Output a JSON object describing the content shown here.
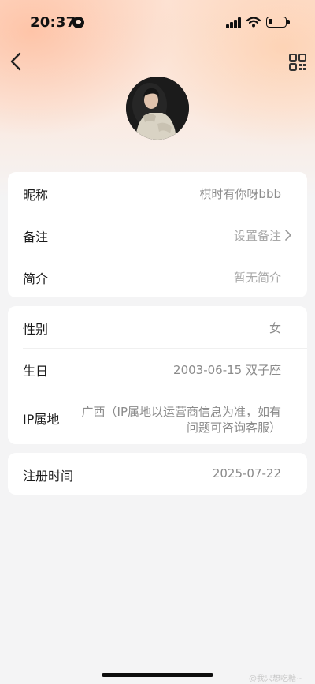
{
  "status_bar": {
    "time": "20:37",
    "battery_level": 0.25
  },
  "header": {
    "back_icon": "chevron-left-icon",
    "qr_icon": "qr-code-icon"
  },
  "profile": {
    "avatar": "avatar"
  },
  "info_card_1": {
    "rows": [
      {
        "label": "昵称",
        "value": "棋时有你呀bbb"
      },
      {
        "label": "备注",
        "value": "设置备注"
      },
      {
        "label": "简介",
        "value": "暂无简介"
      }
    ]
  },
  "info_card_2": {
    "rows": [
      {
        "label": "性别",
        "value": "女"
      },
      {
        "label": "生日",
        "value": "2003-06-15 双子座"
      },
      {
        "label": "IP属地",
        "value_line1": "广西（IP属地以运营商信息为准，如有",
        "value_line2": "问题可咨询客服）"
      }
    ]
  },
  "info_card_3": {
    "rows": [
      {
        "label": "注册时间",
        "value": "2025-07-22"
      }
    ]
  },
  "watermark": "@我只想吃糖~",
  "colors": {
    "accent_gradient": "#fde2d3",
    "text_primary": "#1a1a1a",
    "text_secondary": "#8b8b8b"
  }
}
